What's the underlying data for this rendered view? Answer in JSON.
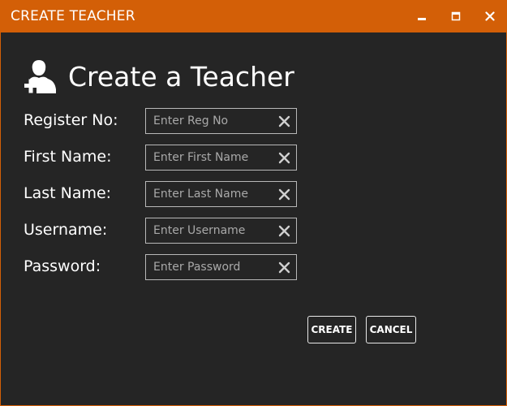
{
  "window": {
    "title": "CREATE TEACHER",
    "accent_color": "#d35f07",
    "background_color": "#252525",
    "controls": [
      "minimize-icon",
      "maximize-icon",
      "close-icon"
    ]
  },
  "header": {
    "icon": "add-user-icon",
    "title": "Create a Teacher"
  },
  "form": {
    "fields": [
      {
        "label": "Register No:",
        "placeholder": "Enter Reg No",
        "value": "",
        "type": "text"
      },
      {
        "label": "First Name:",
        "placeholder": "Enter First Name",
        "value": "",
        "type": "text"
      },
      {
        "label": "Last Name:",
        "placeholder": "Enter Last Name",
        "value": "",
        "type": "text"
      },
      {
        "label": "Username:",
        "placeholder": "Enter Username",
        "value": "",
        "type": "text"
      },
      {
        "label": "Password:",
        "placeholder": "Enter Password",
        "value": "",
        "type": "password"
      }
    ],
    "clear_icon": "clear-icon"
  },
  "actions": {
    "create_label": "CREATE",
    "cancel_label": "CANCEL"
  }
}
